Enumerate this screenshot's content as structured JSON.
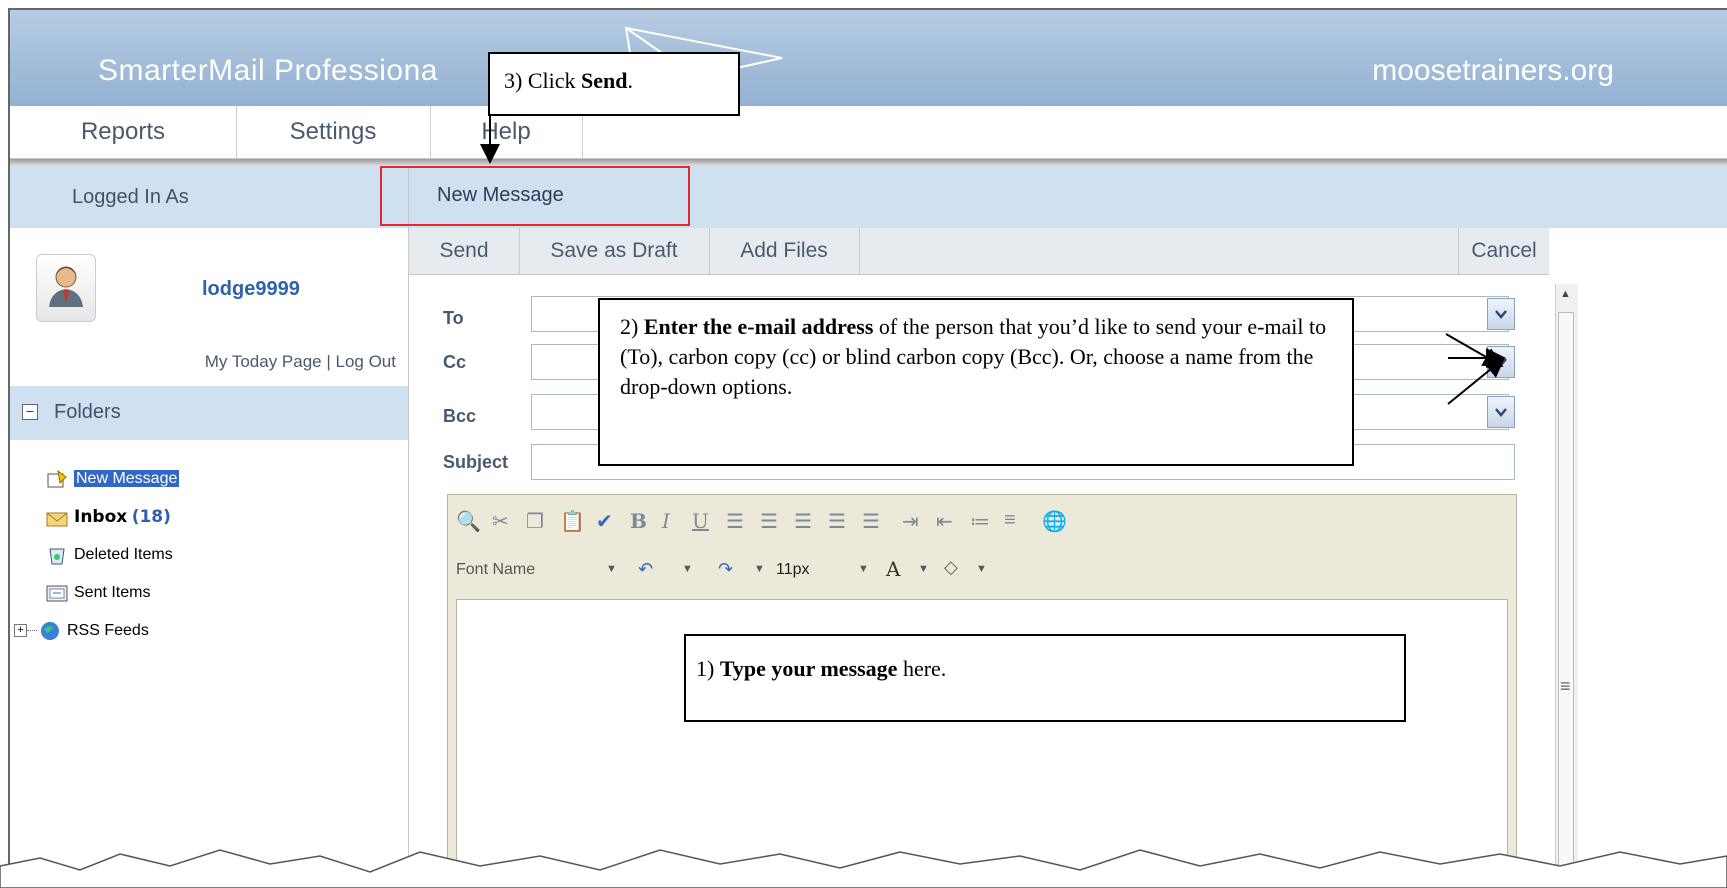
{
  "header": {
    "brand": "SmarterMail Professiona",
    "domain": "moosetrainers.org"
  },
  "nav": {
    "items": [
      "Reports",
      "Settings",
      "Help"
    ]
  },
  "sidebar": {
    "logged_in_label": "Logged In As",
    "username": "lodge9999",
    "my_today_page": "My Today Page",
    "separator": " | ",
    "log_out": "Log Out",
    "folders_label": "Folders",
    "folders": [
      {
        "label": "New Message",
        "icon": "new-message-icon"
      },
      {
        "label": "Inbox",
        "count": "(18)",
        "icon": "inbox-icon"
      },
      {
        "label": "Deleted Items",
        "icon": "deleted-items-icon"
      },
      {
        "label": "Sent Items",
        "icon": "sent-items-icon"
      },
      {
        "label": "RSS Feeds",
        "icon": "rss-feeds-icon"
      }
    ]
  },
  "compose": {
    "title": "New Message",
    "toolbar": {
      "send": "Send",
      "save_draft": "Save as Draft",
      "add_files": "Add Files",
      "cancel": "Cancel"
    },
    "fields": {
      "to": "To",
      "cc": "Cc",
      "bcc": "Bcc",
      "subject": "Subject"
    },
    "editor": {
      "font_name_placeholder": "Font Name",
      "font_size": "11px"
    }
  },
  "callouts": {
    "step3_prefix": "3) Click ",
    "step3_bold": "Send",
    "step3_suffix": ".",
    "step2_prefix": "2) ",
    "step2_bold": "Enter the e-mail address",
    "step2_rest": " of the person that you’d like to send your e-mail to (To), carbon copy (cc) or blind carbon copy (Bcc).  Or, choose a name from the drop-down options.",
    "step1_prefix": "1) ",
    "step1_bold": "Type your message",
    "step1_suffix": " here."
  },
  "colors": {
    "header_gradient_top": "#b7cce2",
    "header_gradient_bottom": "#93b1d2",
    "panel_header": "#cfe0f1",
    "link_blue": "#2f62ad",
    "highlight_red": "#e0282e"
  }
}
